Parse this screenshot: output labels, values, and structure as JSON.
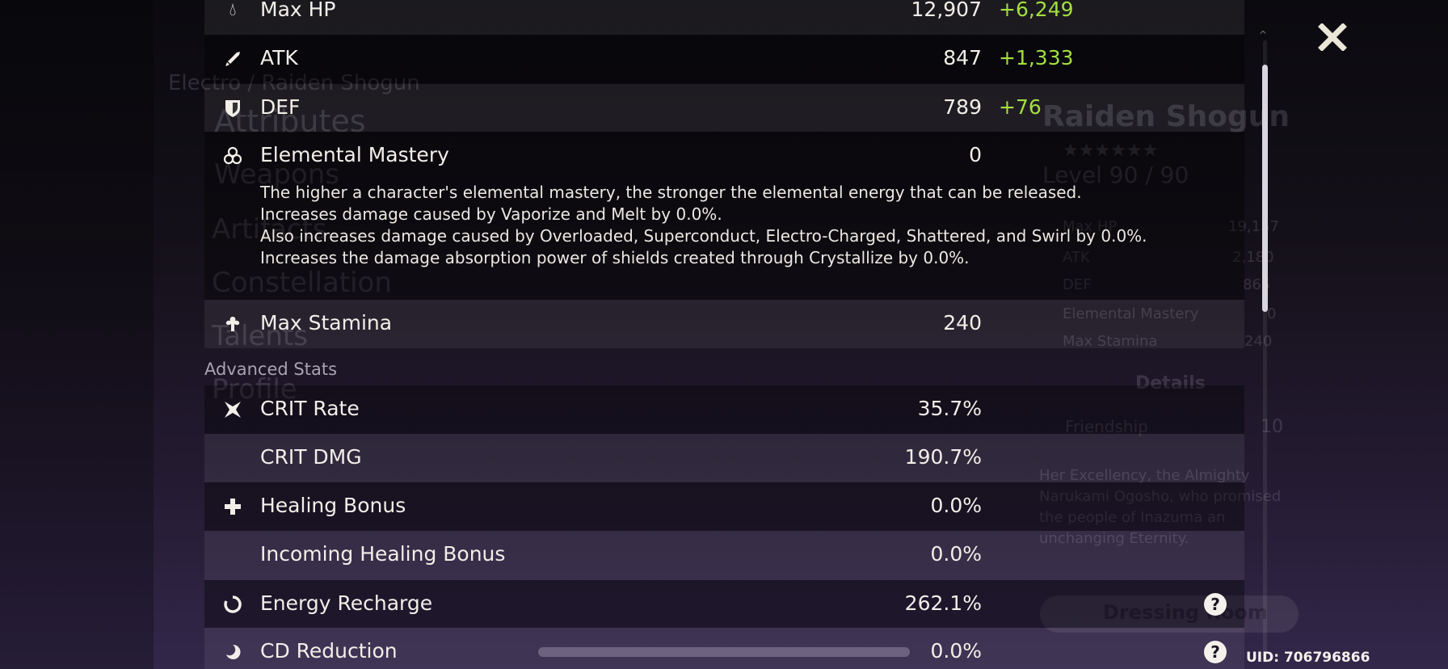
{
  "background": {
    "breadcrumb": "Electro / Raiden Shogun",
    "nav_items": [
      "Attributes",
      "Weapons",
      "Artifacts",
      "Constellation",
      "Talents",
      "Profile"
    ],
    "character_name": "Raiden Shogun",
    "level": "Level 90 / 90",
    "summary_stats": [
      {
        "label": "Max HP",
        "value": "19,157"
      },
      {
        "label": "ATK",
        "value": "2,180"
      },
      {
        "label": "DEF",
        "value": "865"
      },
      {
        "label": "Elemental Mastery",
        "value": "0"
      },
      {
        "label": "Max Stamina",
        "value": "240"
      }
    ],
    "details_label": "Details",
    "friendship_label": "Friendship",
    "friendship_value": "10",
    "bio": "Her Excellency, the Almighty Narukami Ogosho, who promised the people of Inazuma an unchanging Eternity.",
    "dressing_room_label": "Dressing Room"
  },
  "base_stats": [
    {
      "icon": "droplet-icon",
      "label": "Max HP",
      "value": "12,907",
      "bonus": "+6,249"
    },
    {
      "icon": "sword-icon",
      "label": "ATK",
      "value": "847",
      "bonus": "+1,333"
    },
    {
      "icon": "shield-icon",
      "label": "DEF",
      "value": "789",
      "bonus": "+76"
    },
    {
      "icon": "atom-icon",
      "label": "Elemental Mastery",
      "value": "0",
      "bonus": "",
      "description": [
        "The higher a character's elemental mastery, the stronger the elemental energy that can be released.",
        "Increases damage caused by Vaporize and Melt by 0.0%.",
        "Also increases damage caused by Overloaded, Superconduct, Electro-Charged, Shattered, and Swirl by 0.0%.",
        "Increases the damage absorption power of shields created through Crystallize by 0.0%."
      ]
    },
    {
      "icon": "stamina-icon",
      "label": "Max Stamina",
      "value": "240",
      "bonus": ""
    }
  ],
  "advanced_stats_label": "Advanced Stats",
  "advanced_stats": [
    {
      "icon": "crit-icon",
      "label": "CRIT Rate",
      "value": "35.7%"
    },
    {
      "icon": "",
      "label": "CRIT DMG",
      "value": "190.7%"
    },
    {
      "icon": "cross-icon",
      "label": "Healing Bonus",
      "value": "0.0%"
    },
    {
      "icon": "",
      "label": "Incoming Healing Bonus",
      "value": "0.0%"
    },
    {
      "icon": "energy-icon",
      "label": "Energy Recharge",
      "value": "262.1%",
      "help": "?"
    },
    {
      "icon": "cooldown-icon",
      "label": "CD Reduction",
      "value": "0.0%",
      "help": "?"
    }
  ],
  "uid": "UID: 706796866",
  "colors": {
    "bonus_green": "#a3df3f",
    "text": "#f2eee8",
    "section_label": "#a9a2b4"
  }
}
